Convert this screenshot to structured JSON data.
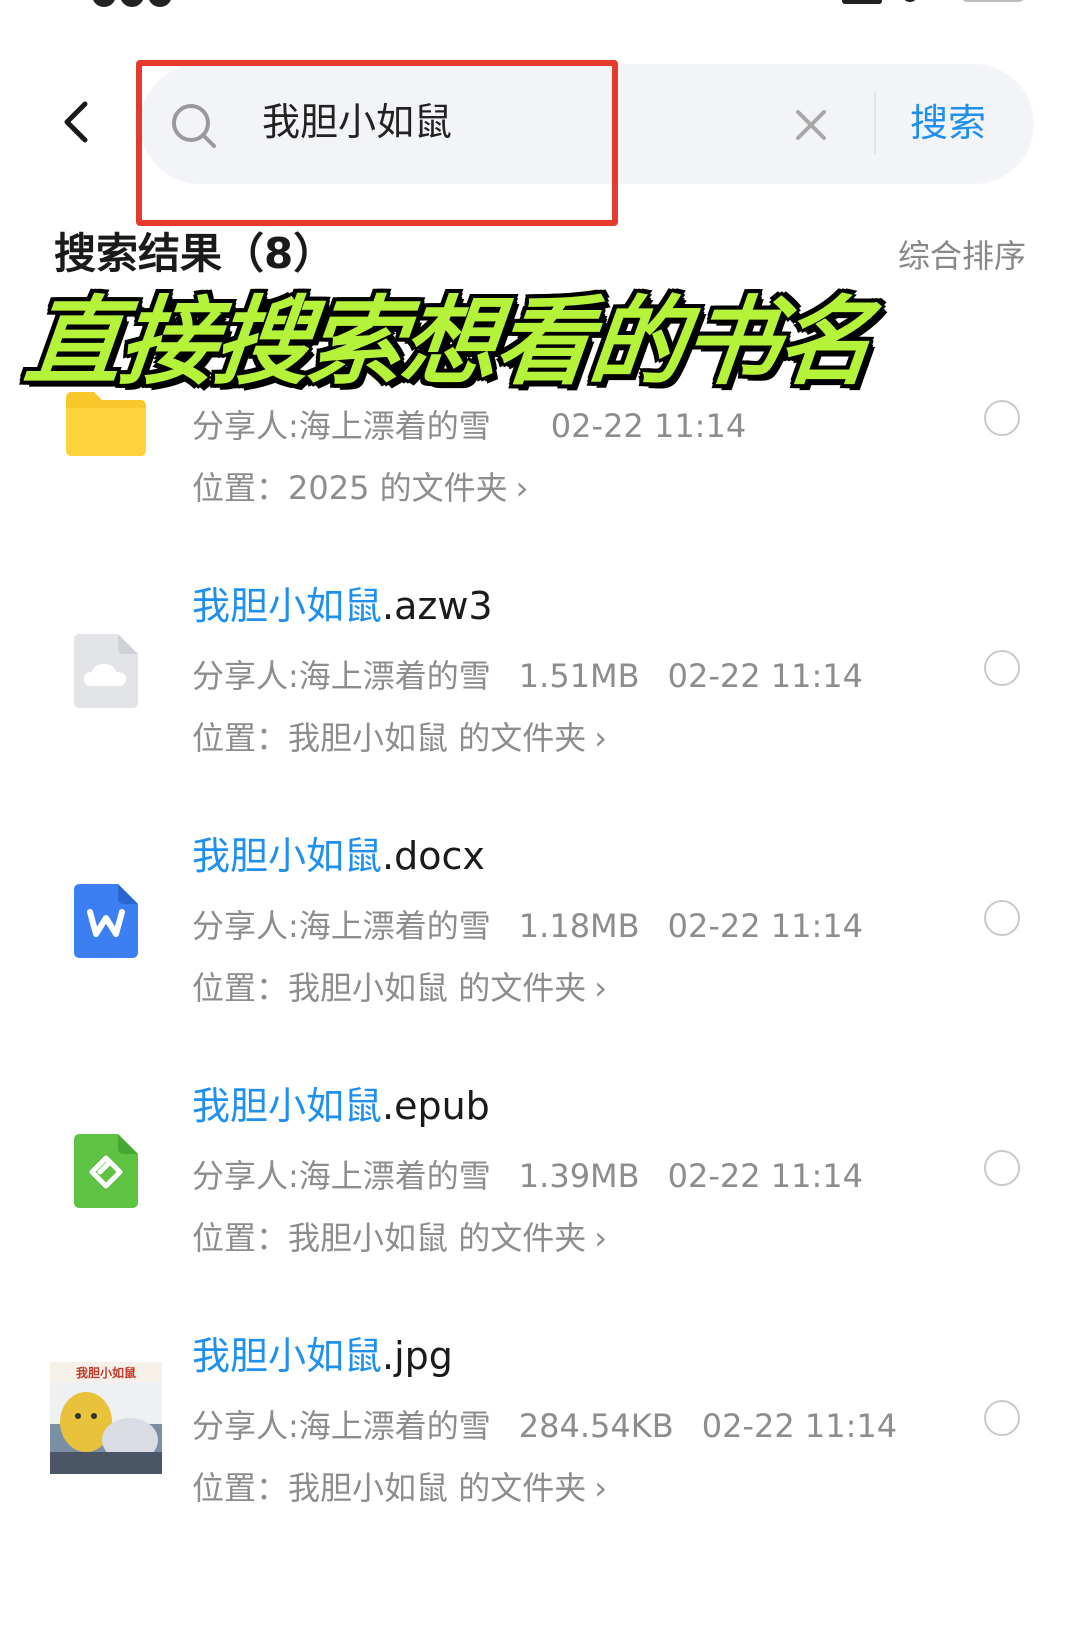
{
  "search": {
    "query": "我胆小如鼠",
    "button_label": "搜索"
  },
  "results": {
    "title": "搜索结果（8）",
    "sort_label": "综合排序"
  },
  "overlay_caption": "直接搜索想看的书名",
  "items": [
    {
      "icon": "folder-icon",
      "name_highlight": "",
      "name_suffix": "",
      "sharer": "分享人:海上漂着的雪",
      "size": "",
      "date": "02-22 11:14",
      "location_label": "位置：",
      "location_value": "2025 的文件夹",
      "chevron": "›"
    },
    {
      "icon": "cloud-file-icon",
      "name_highlight": "我胆小如鼠",
      "name_suffix": ".azw3",
      "sharer": "分享人:海上漂着的雪",
      "size": "1.51MB",
      "date": "02-22 11:14",
      "location_label": "位置：",
      "location_value": "我胆小如鼠 的文件夹",
      "chevron": "›"
    },
    {
      "icon": "word-doc-icon",
      "name_highlight": "我胆小如鼠",
      "name_suffix": ".docx",
      "sharer": "分享人:海上漂着的雪",
      "size": "1.18MB",
      "date": "02-22 11:14",
      "location_label": "位置：",
      "location_value": "我胆小如鼠 的文件夹",
      "chevron": "›"
    },
    {
      "icon": "epub-icon",
      "name_highlight": "我胆小如鼠",
      "name_suffix": ".epub",
      "sharer": "分享人:海上漂着的雪",
      "size": "1.39MB",
      "date": "02-22 11:14",
      "location_label": "位置：",
      "location_value": "我胆小如鼠 的文件夹",
      "chevron": "›"
    },
    {
      "icon": "image-thumbnail-icon",
      "name_highlight": "我胆小如鼠",
      "name_suffix": ".jpg",
      "sharer": "分享人:海上漂着的雪",
      "size": "284.54KB",
      "date": "02-22 11:14",
      "location_label": "位置：",
      "location_value": "我胆小如鼠 的文件夹",
      "chevron": "›",
      "thumbnail_text": "我胆小如鼠"
    }
  ],
  "colors": {
    "accent": "#1f8ff0",
    "highlight_border": "#e53a2c",
    "caption_fill": "#b5f33a",
    "meta_text": "#8d8d8d"
  }
}
